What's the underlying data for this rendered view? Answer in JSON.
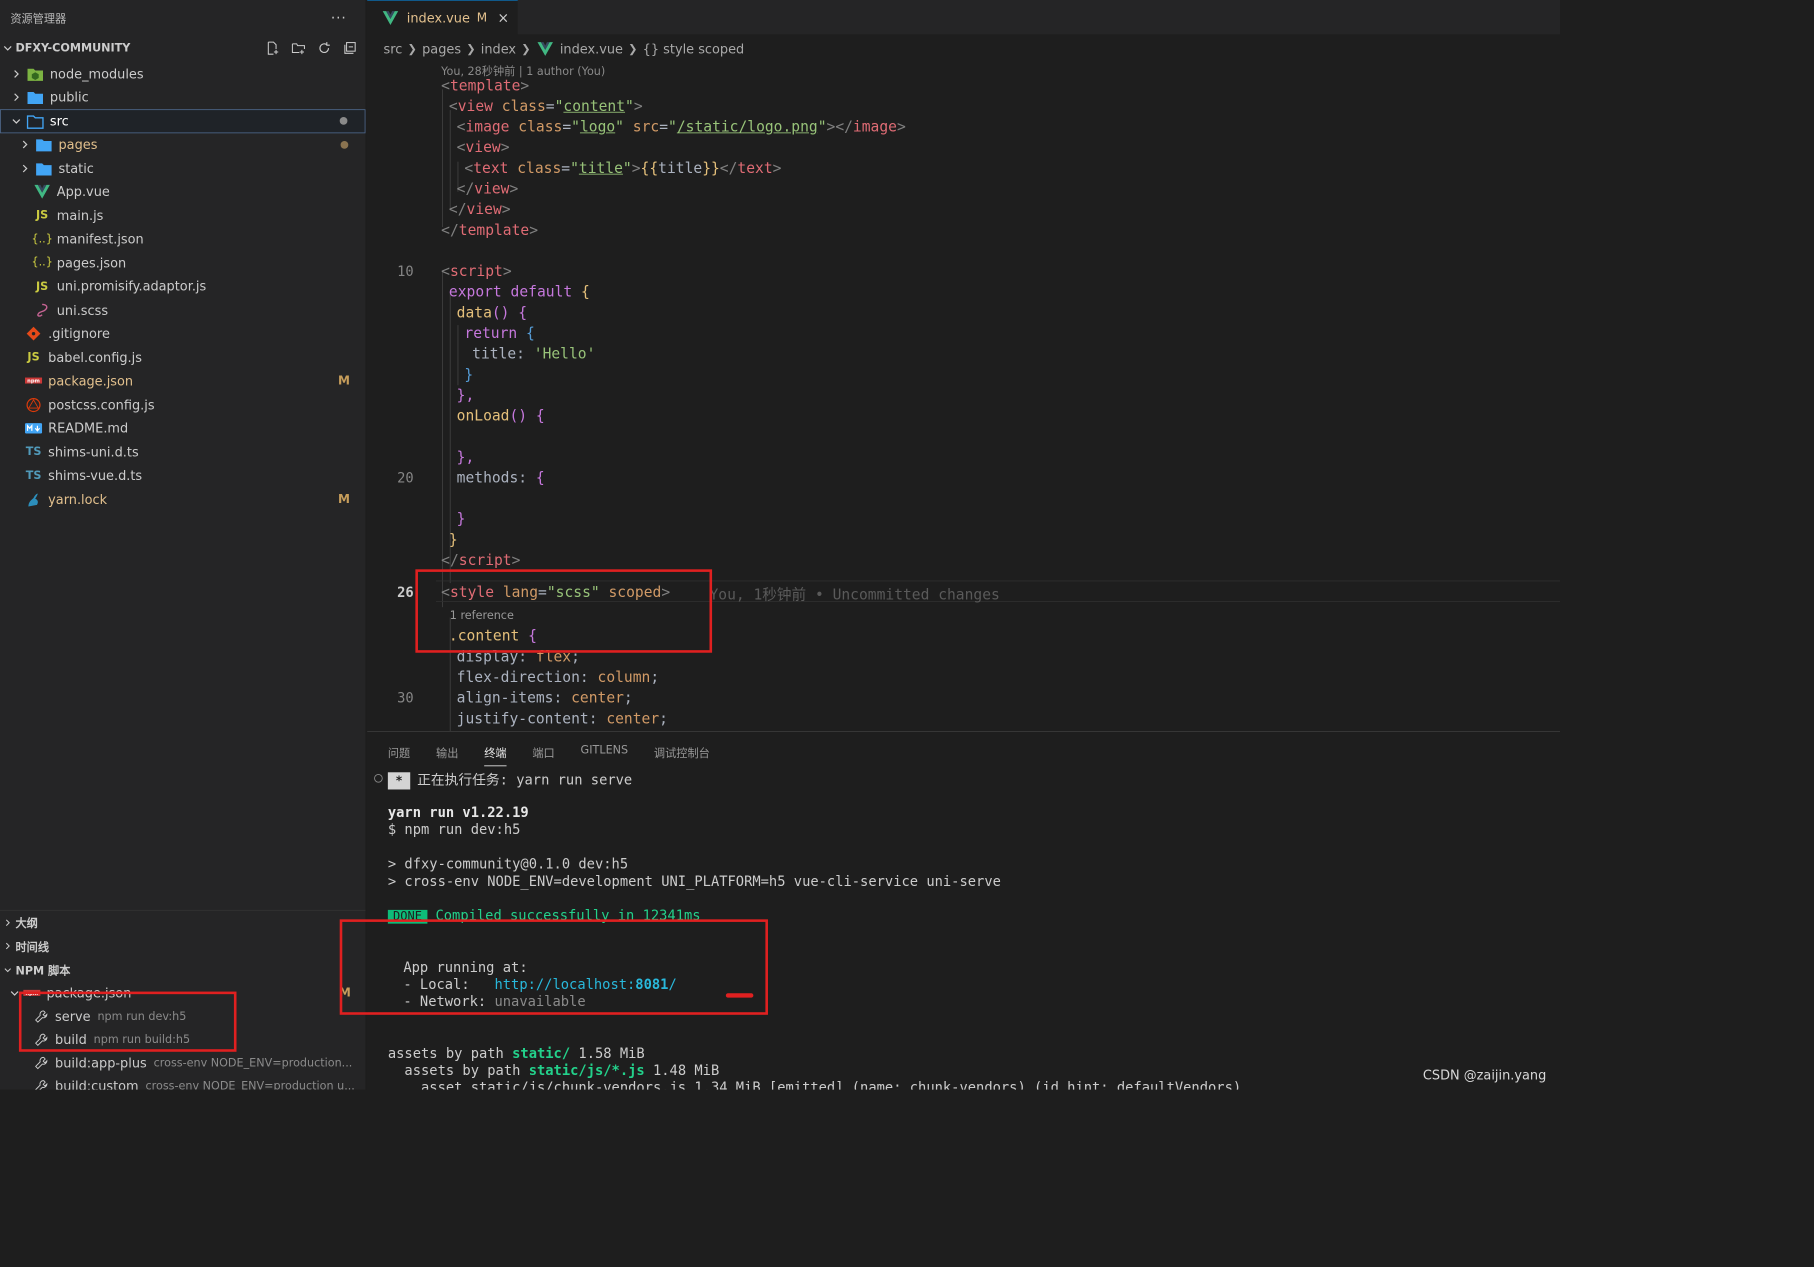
{
  "sidebar": {
    "title": "资源管理器",
    "more": "···",
    "project": "DFXY-COMMUNITY",
    "items": [
      {
        "label": "node_modules",
        "icon": "node-modules-folder-icon",
        "mod": ""
      },
      {
        "label": "public",
        "icon": "folder-icon",
        "mod": ""
      },
      {
        "label": "src",
        "icon": "folder-open-icon",
        "mod": ""
      },
      {
        "label": "pages",
        "icon": "folder-icon",
        "mod": ""
      },
      {
        "label": "static",
        "icon": "folder-icon",
        "mod": ""
      },
      {
        "label": "App.vue",
        "icon": "vue-icon",
        "mod": ""
      },
      {
        "label": "main.js",
        "icon": "js-icon",
        "mod": ""
      },
      {
        "label": "manifest.json",
        "icon": "json-icon",
        "mod": ""
      },
      {
        "label": "pages.json",
        "icon": "json-icon",
        "mod": ""
      },
      {
        "label": "uni.promisify.adaptor.js",
        "icon": "js-icon",
        "mod": ""
      },
      {
        "label": "uni.scss",
        "icon": "sass-icon",
        "mod": ""
      },
      {
        "label": ".gitignore",
        "icon": "git-icon",
        "mod": ""
      },
      {
        "label": "babel.config.js",
        "icon": "js-icon",
        "mod": ""
      },
      {
        "label": "package.json",
        "icon": "npm-icon",
        "mod": "M"
      },
      {
        "label": "postcss.config.js",
        "icon": "postcss-icon",
        "mod": ""
      },
      {
        "label": "README.md",
        "icon": "markdown-icon",
        "mod": ""
      },
      {
        "label": "shims-uni.d.ts",
        "icon": "ts-icon",
        "mod": ""
      },
      {
        "label": "shims-vue.d.ts",
        "icon": "ts-icon",
        "mod": ""
      },
      {
        "label": "yarn.lock",
        "icon": "yarn-icon",
        "mod": "M"
      }
    ],
    "sections": {
      "outline": "大纲",
      "timeline": "时间线",
      "npm": "NPM 脚本"
    },
    "npm": {
      "file": "package.json",
      "file_mod": "M",
      "scripts": [
        {
          "name": "serve",
          "cmd": "npm run dev:h5"
        },
        {
          "name": "build",
          "cmd": "npm run build:h5"
        },
        {
          "name": "build:app-plus",
          "cmd": "cross-env NODE_ENV=production..."
        },
        {
          "name": "build:custom",
          "cmd": "cross-env NODE_ENV=production u..."
        }
      ]
    }
  },
  "editor": {
    "tab": {
      "label": "index.vue",
      "mod": "M",
      "close": "×"
    },
    "breadcrumb": [
      "src",
      "pages",
      "index",
      "index.vue",
      "{} style scoped"
    ],
    "blame": "You, 28秒钟前 | 1 author (You)",
    "line_numbers": [
      "10",
      "20",
      "26",
      "30"
    ],
    "codelens": "1 reference",
    "ghost": "You, 1秒钟前 • Uncommitted changes"
  },
  "panel": {
    "tabs": [
      "问题",
      "输出",
      "终端",
      "端口",
      "GITLENS",
      "调试控制台"
    ],
    "active_tab": "终端",
    "task": {
      "box": "*",
      "text": "正在执行任务: yarn run serve"
    },
    "yarn": "yarn run v1.22.19",
    "npm_cmd": "$ npm run dev:h5",
    "l1": "> dfxy-community@0.1.0 dev:h5",
    "l2": "> cross-env NODE_ENV=development UNI_PLATFORM=h5 vue-cli-service uni-serve",
    "done": "DONE",
    "compiled": " Compiled successfully in 12341ms",
    "app_running": "App running at:",
    "local_label": "- Local:   ",
    "local_url": "http://localhost:",
    "local_port": "8081",
    "local_slash": "/",
    "network_label": "- Network: ",
    "network_val": "unavailable",
    "assets1a": "assets by path ",
    "assets1b": "static/",
    "assets1c": " 1.58 MiB",
    "assets2a": "  assets by path ",
    "assets2b": "static/js/*.js",
    "assets2c": " 1.48 MiB",
    "assets3": "    asset static/js/chunk-vendors.js 1.34 MiB [emitted] (name: chunk-vendors) (id hint: defaultVendors)"
  },
  "watermark": "CSDN @zaijin.yang",
  "colors": {
    "accent": "#0e639c",
    "modified": "#e2c08d",
    "annotation": "#e02020"
  }
}
